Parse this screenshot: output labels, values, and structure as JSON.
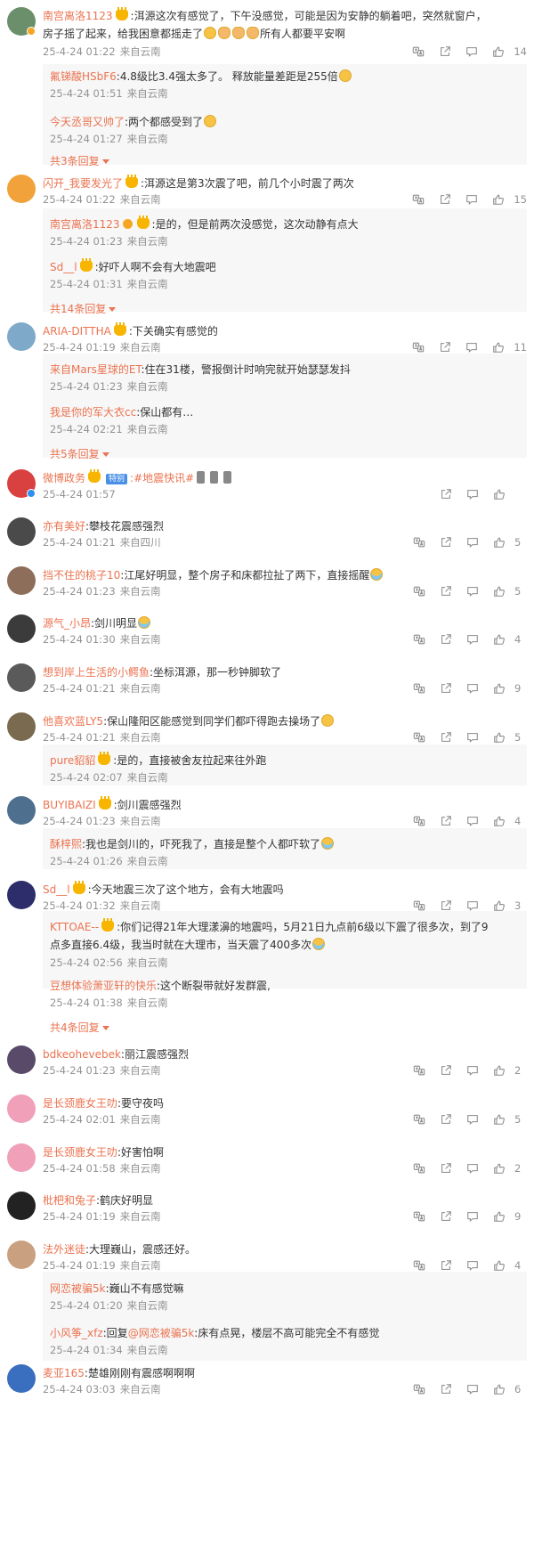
{
  "icons": {
    "translate": "translate-icon",
    "share": "share-icon",
    "comment": "comment-icon",
    "like": "like-icon"
  },
  "colors": {
    "accent": "#eb7350",
    "meta": "#939393",
    "reply_bg": "#f7f7f7"
  },
  "comments": [
    {
      "user": "南宫离洛1123",
      "text": ":洱源这次有感觉了，下午没感觉，可能是因为安静的躺着吧，突然就窗户，",
      "text2": "房子摇了起来，给我困意都摇走了",
      "text3": "所有人都要平安啊",
      "time": "25-4-24 01:22",
      "loc": "来自云南",
      "likes": "14",
      "replies": [
        {
          "user": "氟锑酸HSbF6",
          "text": ":4.8级比3.4强太多了。 释放能量差距是255倍",
          "time": "25-4-24 01:51",
          "loc": "来自云南"
        },
        {
          "user": "今天丞哥又帅了",
          "text": ":两个都感受到了",
          "time": "25-4-24 01:27",
          "loc": "来自云南"
        }
      ],
      "more": "共3条回复"
    },
    {
      "user": "闪开_我要发光了",
      "text": ":洱源这是第3次震了吧，前几个小时震了两次",
      "time": "25-4-24 01:22",
      "loc": "来自云南",
      "likes": "15",
      "replies": [
        {
          "user": "南宫离洛1123",
          "text": ":是的，但是前两次没感觉，这次动静有点大",
          "time": "25-4-24 01:23",
          "loc": "来自云南"
        },
        {
          "user": "Sd__l",
          "text": ":好吓人啊不会有大地震吧",
          "time": "25-4-24 01:31",
          "loc": "来自云南"
        }
      ],
      "more": "共14条回复"
    },
    {
      "user": "ARIA-DITTHA",
      "text": ":下关确实有感觉的",
      "time": "25-4-24 01:19",
      "loc": "来自云南",
      "likes": "11",
      "replies": [
        {
          "user": "来自Mars星球的ET",
          "text": ":住在31楼，警报倒计时响完就开始瑟瑟发抖",
          "time": "25-4-24 01:23",
          "loc": "来自云南"
        },
        {
          "user": "我是你的军大衣cc",
          "text": ":保山都有…",
          "time": "25-4-24 02:21",
          "loc": "来自云南"
        }
      ],
      "more": "共5条回复"
    },
    {
      "user": "微博政务",
      "tag": "特别",
      "text": ":#地震快讯#",
      "time": "25-4-24 01:57",
      "loc": "",
      "likes": ""
    },
    {
      "user": "亦有美好",
      "text": ":攀枝花震感强烈",
      "time": "25-4-24 01:21",
      "loc": "来自四川",
      "likes": "5"
    },
    {
      "user": "挡不住的桃子10",
      "text": ":江尾好明显，整个房子和床都拉扯了两下，直接摇醒",
      "time": "25-4-24 01:23",
      "loc": "来自云南",
      "likes": "5"
    },
    {
      "user": "源气_小昂",
      "text": ":剑川明显",
      "time": "25-4-24 01:30",
      "loc": "来自云南",
      "likes": "4"
    },
    {
      "user": "想到岸上生活的小鳄鱼",
      "text": ":坐标洱源，那一秒钟脚软了",
      "time": "25-4-24 01:21",
      "loc": "来自云南",
      "likes": "9"
    },
    {
      "user": "他喜欢蓝LY5",
      "text": ":保山隆阳区能感觉到同学们都吓得跑去操场了",
      "time": "25-4-24 01:21",
      "loc": "来自云南",
      "likes": "5",
      "replies": [
        {
          "user": "pure貂貂",
          "text": ":是的，直接被舍友拉起来往外跑",
          "time": "25-4-24 02:07",
          "loc": "来自云南"
        }
      ]
    },
    {
      "user": "BUYIBAIZI",
      "text": ":剑川震感强烈",
      "time": "25-4-24 01:23",
      "loc": "来自云南",
      "likes": "4",
      "replies": [
        {
          "user": "酥梓熙",
          "text": ":我也是剑川的，吓死我了，直接是整个人都吓软了",
          "time": "25-4-24 01:26",
          "loc": "来自云南"
        }
      ]
    },
    {
      "user": "Sd__l",
      "text": ":今天地震三次了这个地方，会有大地震吗",
      "time": "25-4-24 01:32",
      "loc": "来自云南",
      "likes": "3",
      "replies": [
        {
          "user": "KTTOAE--",
          "text": ":你们记得21年大理漾濞的地震吗，5月21日九点前6级以下震了很多次，到了9",
          "text2": "点多直接6.4级，我当时就在大理市，当天震了400多次",
          "time": "25-4-24 02:56",
          "loc": "来自云南"
        },
        {
          "user": "豆想体验萧亚轩的快乐",
          "text": ":这个断裂带就好发群震,",
          "time": "25-4-24 01:38",
          "loc": "来自云南"
        }
      ],
      "more": "共4条回复"
    },
    {
      "user": "bdkeohevebek",
      "text": ":丽江震感强烈",
      "time": "25-4-24 01:23",
      "loc": "来自云南",
      "likes": "2"
    },
    {
      "user": "是长颈鹿女王叻",
      "text": ":要守夜吗",
      "time": "25-4-24 02:01",
      "loc": "来自云南",
      "likes": "5"
    },
    {
      "user": "是长颈鹿女王叻",
      "text": ":好害怕啊",
      "time": "25-4-24 01:58",
      "loc": "来自云南",
      "likes": "2"
    },
    {
      "user": "枇杷和兔子",
      "text": ":鹤庆好明显",
      "time": "25-4-24 01:19",
      "loc": "来自云南",
      "likes": "9"
    },
    {
      "user": "法外迷徒",
      "text": ":大理巍山，震感还好。",
      "time": "25-4-24 01:19",
      "loc": "来自云南",
      "likes": "4",
      "replies": [
        {
          "user": "网恋被骗5k",
          "text": ":巍山不有感觉嘛",
          "time": "25-4-24 01:20",
          "loc": "来自云南"
        },
        {
          "user": "小风筝_xfz",
          "text": ":回复",
          "mention": "@网恋被骗5k",
          "text_after": ":床有点晃，楼层不高可能完全不有感觉",
          "time": "25-4-24 01:34",
          "loc": "来自云南"
        }
      ]
    },
    {
      "user": "麦亚165",
      "text": ":楚雄刚刚有震感啊啊啊",
      "time": "25-4-24 03:03",
      "loc": "来自云南",
      "likes": "6"
    }
  ]
}
